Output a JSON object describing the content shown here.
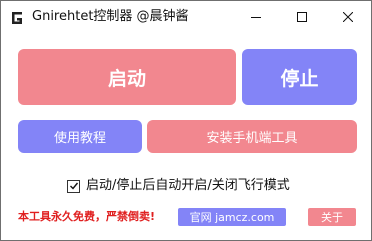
{
  "window": {
    "title": "Gnirehtet控制器 @晨钟酱",
    "icon": "g-logo-icon",
    "controls": [
      "minimize-icon",
      "maximize-icon",
      "close-icon"
    ]
  },
  "main": {
    "start_label": "启动",
    "stop_label": "停止",
    "guide_label": "使用教程",
    "install_label": "安装手机端工具"
  },
  "options": {
    "auto_flight_mode_label": "启动/停止后自动开启/关闭飞行模式",
    "auto_flight_mode_checked": true
  },
  "footer": {
    "notice": "本工具永久免费，严禁倒卖!",
    "site_label": "官网 jamcz.com",
    "about_label": "关于"
  },
  "colors": {
    "pink": "#f2878f",
    "purple": "#8384f7",
    "notice_red": "#e02020"
  }
}
